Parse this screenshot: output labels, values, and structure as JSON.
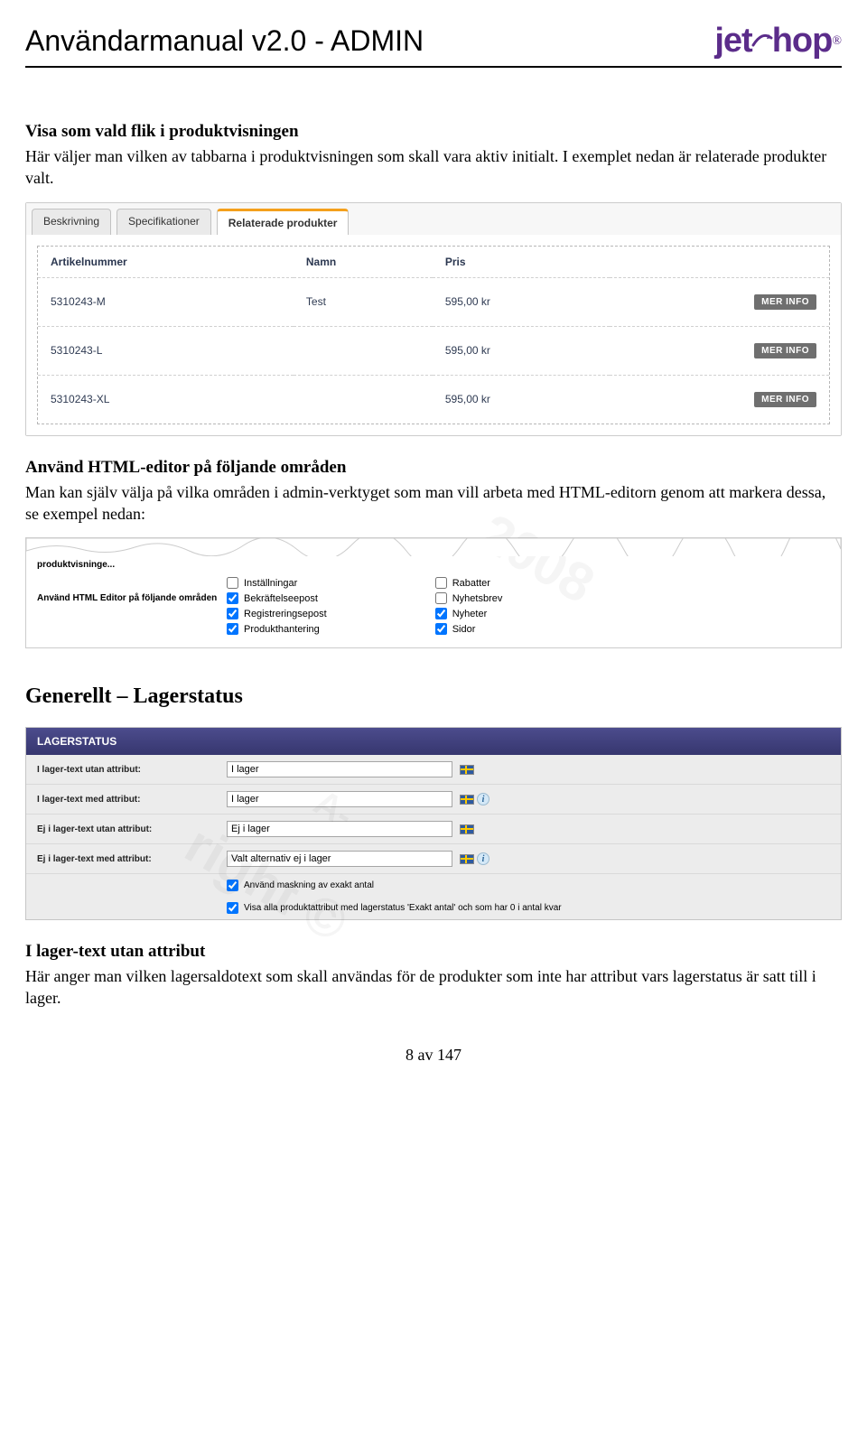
{
  "header": {
    "title": "Användarmanual v2.0 - ADMIN",
    "logo_text": "jetshop",
    "logo_reg": "®"
  },
  "section1": {
    "heading": "Visa som vald flik i produktvisningen",
    "body": "Här väljer man vilken av tabbarna i produktvisningen som skall vara aktiv initialt. I exemplet nedan är relaterade produkter valt."
  },
  "tabs": {
    "items": [
      "Beskrivning",
      "Specifikationer",
      "Relaterade produkter"
    ],
    "columns": {
      "artno": "Artikelnummer",
      "name": "Namn",
      "price": "Pris"
    },
    "rows": [
      {
        "artno": "5310243-M",
        "name": "Test",
        "price": "595,00 kr"
      },
      {
        "artno": "5310243-L",
        "name": "",
        "price": "595,00 kr"
      },
      {
        "artno": "5310243-XL",
        "name": "",
        "price": "595,00 kr"
      }
    ],
    "more_info": "MER INFO"
  },
  "section2": {
    "heading": "Använd HTML-editor på följande områden",
    "body": "Man kan själv välja på vilka områden i admin-verktyget som man vill arbeta med HTML-editorn genom att markera dessa, se exempel nedan:"
  },
  "editor": {
    "top_label": "produktvisninge...",
    "side_label": "Använd HTML Editor på följande områden",
    "col1": [
      {
        "label": "Inställningar",
        "checked": false
      },
      {
        "label": "Bekräftelseepost",
        "checked": true
      },
      {
        "label": "Registreringsepost",
        "checked": true
      },
      {
        "label": "Produkthantering",
        "checked": true
      }
    ],
    "col2": [
      {
        "label": "Rabatter",
        "checked": false
      },
      {
        "label": "Nyhetsbrev",
        "checked": false
      },
      {
        "label": "Nyheter",
        "checked": true
      },
      {
        "label": "Sidor",
        "checked": true
      }
    ]
  },
  "section3": {
    "title": "Generellt – Lagerstatus"
  },
  "lager": {
    "header": "LAGERSTATUS",
    "rows": [
      {
        "label": "I lager-text utan attribut:",
        "value": "I lager",
        "info": false
      },
      {
        "label": "I lager-text med attribut:",
        "value": "I lager",
        "info": true
      },
      {
        "label": "Ej i lager-text utan attribut:",
        "value": "Ej i lager",
        "info": false
      },
      {
        "label": "Ej i lager-text med attribut:",
        "value": "Valt alternativ ej i lager",
        "info": true
      }
    ],
    "checks": [
      {
        "label": "Använd maskning av exakt antal",
        "checked": true
      },
      {
        "label": "Visa alla produktattribut med lagerstatus 'Exakt antal' och som har 0 i antal kvar",
        "checked": true
      }
    ]
  },
  "section4": {
    "heading": "I lager-text utan attribut",
    "body": "Här anger man vilken lagersaldotext som skall användas för de produkter som inte har attribut vars lagerstatus är satt till i lager."
  },
  "footer": {
    "page": "8 av 147"
  },
  "watermark": {
    "w1": "2008",
    "w2": "right ©",
    "w3": "A-"
  }
}
